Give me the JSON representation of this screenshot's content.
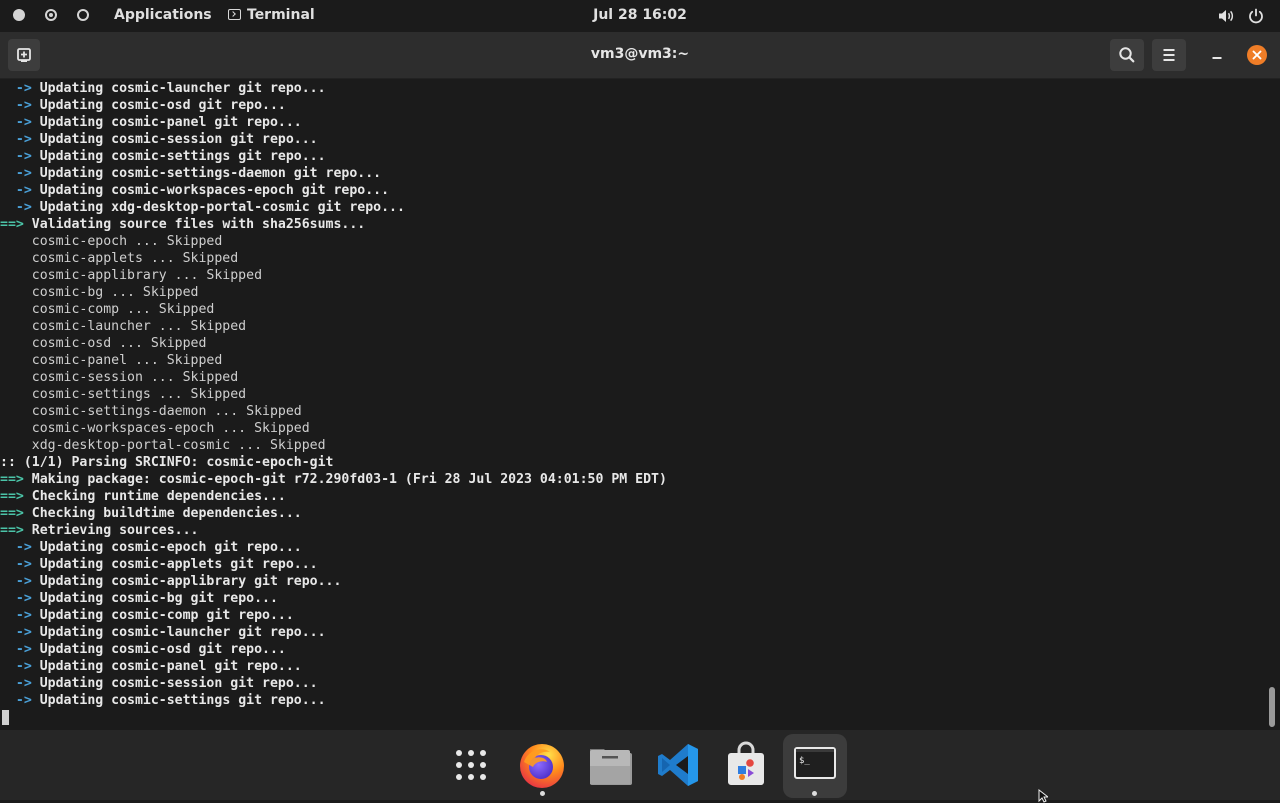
{
  "topbar": {
    "applications_label": "Applications",
    "terminal_label": "Terminal",
    "clock": "Jul 28  16:02"
  },
  "window": {
    "title": "vm3@vm3:~"
  },
  "terminal": {
    "lines": [
      {
        "p": "  -> ",
        "t": "Updating cosmic-launcher git repo...",
        "k": "arrow"
      },
      {
        "p": "  -> ",
        "t": "Updating cosmic-osd git repo...",
        "k": "arrow"
      },
      {
        "p": "  -> ",
        "t": "Updating cosmic-panel git repo...",
        "k": "arrow"
      },
      {
        "p": "  -> ",
        "t": "Updating cosmic-session git repo...",
        "k": "arrow"
      },
      {
        "p": "  -> ",
        "t": "Updating cosmic-settings git repo...",
        "k": "arrow"
      },
      {
        "p": "  -> ",
        "t": "Updating cosmic-settings-daemon git repo...",
        "k": "arrow"
      },
      {
        "p": "  -> ",
        "t": "Updating cosmic-workspaces-epoch git repo...",
        "k": "arrow"
      },
      {
        "p": "  -> ",
        "t": "Updating xdg-desktop-portal-cosmic git repo...",
        "k": "arrow"
      },
      {
        "p": "==> ",
        "t": "Validating source files with sha256sums...",
        "k": "head"
      },
      {
        "p": "",
        "t": "    cosmic-epoch ... Skipped",
        "k": "plain"
      },
      {
        "p": "",
        "t": "    cosmic-applets ... Skipped",
        "k": "plain"
      },
      {
        "p": "",
        "t": "    cosmic-applibrary ... Skipped",
        "k": "plain"
      },
      {
        "p": "",
        "t": "    cosmic-bg ... Skipped",
        "k": "plain"
      },
      {
        "p": "",
        "t": "    cosmic-comp ... Skipped",
        "k": "plain"
      },
      {
        "p": "",
        "t": "    cosmic-launcher ... Skipped",
        "k": "plain"
      },
      {
        "p": "",
        "t": "    cosmic-osd ... Skipped",
        "k": "plain"
      },
      {
        "p": "",
        "t": "    cosmic-panel ... Skipped",
        "k": "plain"
      },
      {
        "p": "",
        "t": "    cosmic-session ... Skipped",
        "k": "plain"
      },
      {
        "p": "",
        "t": "    cosmic-settings ... Skipped",
        "k": "plain"
      },
      {
        "p": "",
        "t": "    cosmic-settings-daemon ... Skipped",
        "k": "plain"
      },
      {
        "p": "",
        "t": "    cosmic-workspaces-epoch ... Skipped",
        "k": "plain"
      },
      {
        "p": "",
        "t": "    xdg-desktop-portal-cosmic ... Skipped",
        "k": "plain"
      },
      {
        "p": "",
        "t": ":: (1/1) Parsing SRCINFO: cosmic-epoch-git",
        "k": "bold"
      },
      {
        "p": "==> ",
        "t": "Making package: cosmic-epoch-git r72.290fd03-1 (Fri 28 Jul 2023 04:01:50 PM EDT)",
        "k": "head"
      },
      {
        "p": "==> ",
        "t": "Checking runtime dependencies...",
        "k": "head"
      },
      {
        "p": "==> ",
        "t": "Checking buildtime dependencies...",
        "k": "head"
      },
      {
        "p": "==> ",
        "t": "Retrieving sources...",
        "k": "head"
      },
      {
        "p": "  -> ",
        "t": "Updating cosmic-epoch git repo...",
        "k": "arrow"
      },
      {
        "p": "  -> ",
        "t": "Updating cosmic-applets git repo...",
        "k": "arrow"
      },
      {
        "p": "  -> ",
        "t": "Updating cosmic-applibrary git repo...",
        "k": "arrow"
      },
      {
        "p": "  -> ",
        "t": "Updating cosmic-bg git repo...",
        "k": "arrow"
      },
      {
        "p": "  -> ",
        "t": "Updating cosmic-comp git repo...",
        "k": "arrow"
      },
      {
        "p": "  -> ",
        "t": "Updating cosmic-launcher git repo...",
        "k": "arrow"
      },
      {
        "p": "  -> ",
        "t": "Updating cosmic-osd git repo...",
        "k": "arrow"
      },
      {
        "p": "  -> ",
        "t": "Updating cosmic-panel git repo...",
        "k": "arrow"
      },
      {
        "p": "  -> ",
        "t": "Updating cosmic-session git repo...",
        "k": "arrow"
      },
      {
        "p": "  -> ",
        "t": "Updating cosmic-settings git repo...",
        "k": "arrow"
      }
    ]
  },
  "dock": {
    "items": [
      "app-library-icon",
      "firefox-icon",
      "files-icon",
      "vscode-icon",
      "store-icon",
      "terminal-icon"
    ],
    "terminal_glyph": "$_"
  },
  "colors": {
    "arrow_prefix": "#4aa0d8",
    "head_prefix": "#4bc4a8",
    "close_button": "#ef7d27"
  }
}
